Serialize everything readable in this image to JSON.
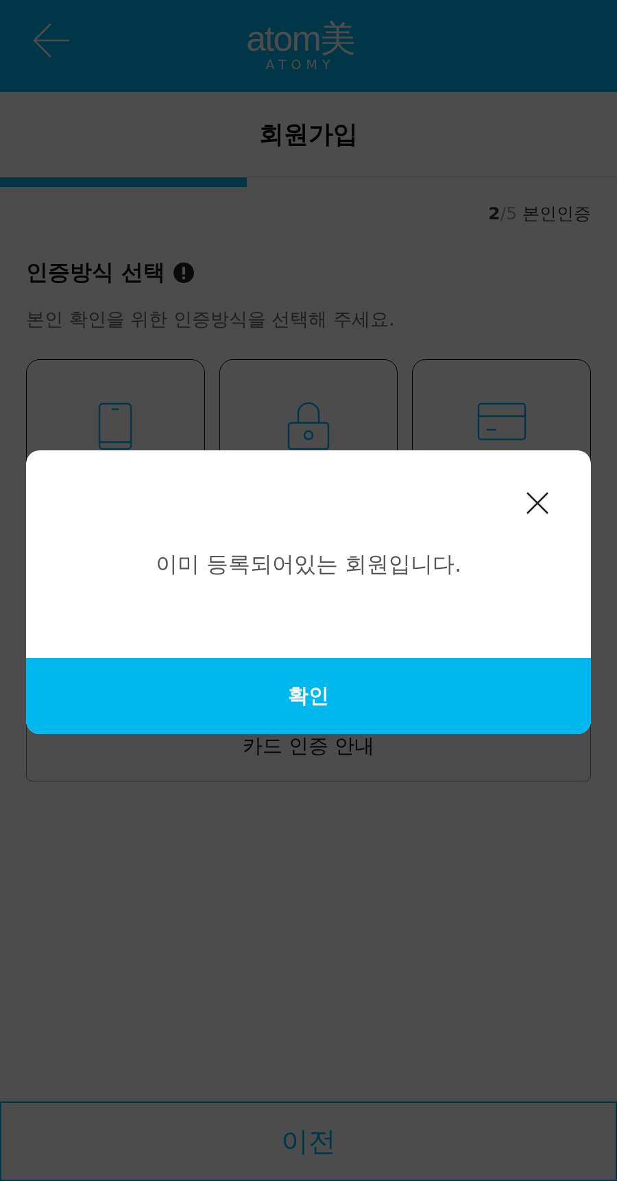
{
  "header": {
    "logo_mark": "atom美",
    "logo_sub": "ATOMY"
  },
  "title": "회원가입",
  "progress": {
    "level": 0.4,
    "step_current": "2",
    "step_total": "/5",
    "step_label": "본인인증"
  },
  "section": {
    "heading": "인증방식 선택",
    "description": "본인 확인을 위한 인증방식을 선택해 주세요."
  },
  "methods": [
    {
      "kind": "phone"
    },
    {
      "kind": "lock"
    },
    {
      "kind": "card"
    }
  ],
  "card_guide": "카드 인증 안내",
  "footer_button": "이전",
  "dialog": {
    "message": "이미 등록되어있는 회원입니다.",
    "confirm": "확인"
  }
}
